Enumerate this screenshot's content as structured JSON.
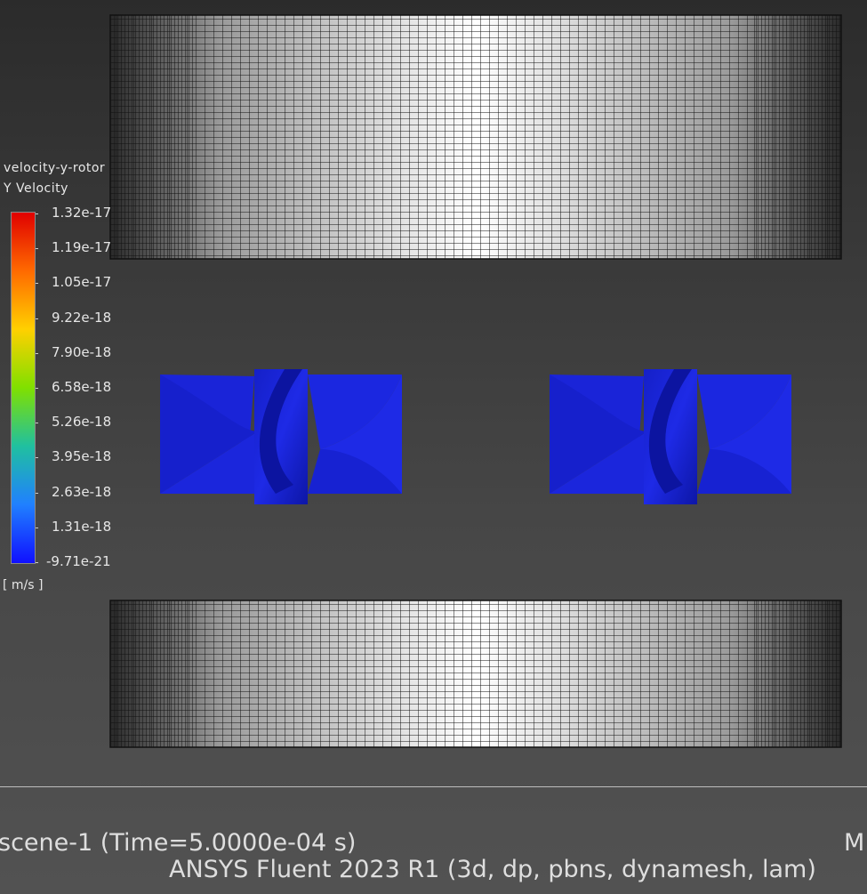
{
  "legend": {
    "title_line1": "velocity-y-rotor",
    "title_line2": "Y Velocity",
    "unit": "[ m/s ]",
    "ticks": [
      "1.32e-17",
      "1.19e-17",
      "1.05e-17",
      "9.22e-18",
      "7.90e-18",
      "6.58e-18",
      "5.26e-18",
      "3.95e-18",
      "2.63e-18",
      "1.31e-18",
      "-9.71e-21"
    ],
    "colors": [
      "#e00000",
      "#ff6a00",
      "#ffd000",
      "#80e000",
      "#20c0a0",
      "#2080ff",
      "#1010ff"
    ]
  },
  "footer": {
    "scene": "scene-1  (Time=5.0000e-04 s)",
    "right_cut": "M",
    "solver": "ANSYS Fluent 2023 R1 (3d, dp, pbns, dynamesh, lam)"
  },
  "colors": {
    "rotor_blue": "#1a24d8",
    "rotor_dark": "#0c14a0",
    "mesh_light": "#f2f2f2",
    "mesh_dark": "#151515"
  }
}
